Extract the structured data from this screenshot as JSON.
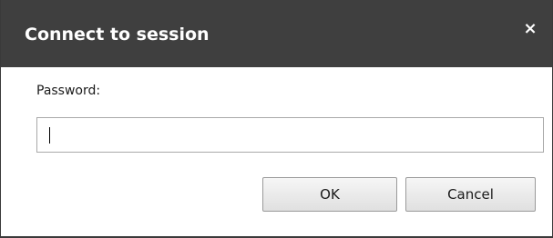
{
  "dialog": {
    "title": "Connect to session",
    "close_symbol": "×",
    "password_label": "Password:",
    "password_value": "",
    "ok_label": "OK",
    "cancel_label": "Cancel",
    "icons": {
      "close": "close-icon"
    },
    "colors": {
      "titlebar": "#3f3f3f",
      "title_text": "#ffffff",
      "border": "#3a3a3a",
      "button_bg": "#e0e0e0"
    }
  }
}
